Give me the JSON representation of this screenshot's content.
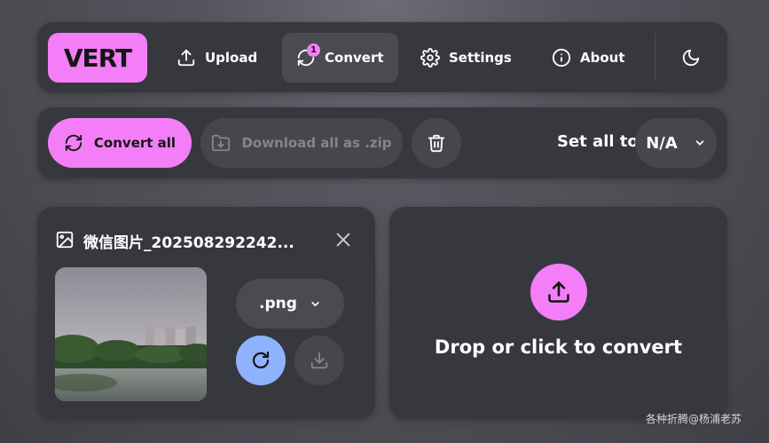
{
  "nav": {
    "logo": "VERT",
    "items": [
      {
        "label": "Upload",
        "icon": "upload-icon"
      },
      {
        "label": "Convert",
        "icon": "refresh-icon",
        "badge": "1",
        "active": true
      },
      {
        "label": "Settings",
        "icon": "gear-icon"
      },
      {
        "label": "About",
        "icon": "info-icon"
      }
    ],
    "theme_icon": "moon-icon"
  },
  "toolbar": {
    "convert_all_label": "Convert all",
    "download_all_label": "Download all as .zip",
    "set_all_label": "Set all to",
    "set_all_value": "N/A"
  },
  "file": {
    "name": "微信图片_202508292242...",
    "format": ".png"
  },
  "dropzone": {
    "label": "Drop or click to convert"
  },
  "watermark": "各种折腾@杨浦老苏",
  "colors": {
    "accent": "#f47ef7",
    "convert_blue": "#8fb2ff",
    "panel": "#37383d"
  }
}
